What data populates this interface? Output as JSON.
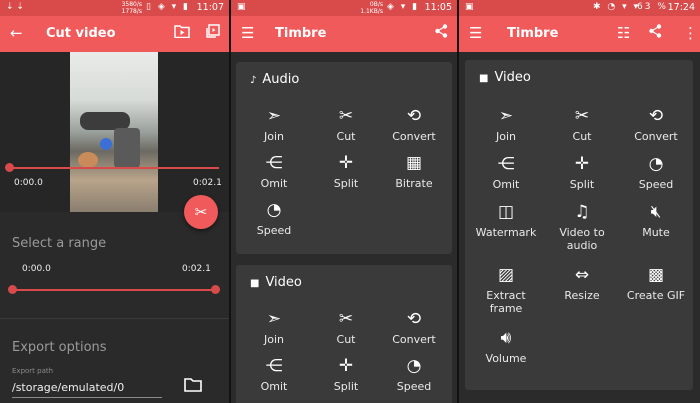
{
  "screen1": {
    "status": {
      "left": "⇣ ⇣",
      "speed": "3580/s\n1778/s",
      "time": "11:07"
    },
    "appbar": {
      "title": "Cut video"
    },
    "video": {
      "start_time": "0:00.0",
      "end_time": "0:02.1"
    },
    "range": {
      "title": "Select a range",
      "start": "0:00.0",
      "end": "0:02.1"
    },
    "export": {
      "title": "Export options",
      "label": "Export path",
      "value": "/storage/emulated/0"
    }
  },
  "screen2": {
    "status": {
      "time": "11:05",
      "speed": "0B/s\n1.1KB/s"
    },
    "appbar": {
      "title": "Timbre"
    },
    "audio_card": {
      "title": "Audio",
      "tools": [
        {
          "label": "Join",
          "icon": "join-icon"
        },
        {
          "label": "Cut",
          "icon": "scissors-icon"
        },
        {
          "label": "Convert",
          "icon": "convert-icon"
        },
        {
          "label": "Omit",
          "icon": "omit-icon"
        },
        {
          "label": "Split",
          "icon": "split-icon"
        },
        {
          "label": "Bitrate",
          "icon": "bitrate-icon"
        },
        {
          "label": "Speed",
          "icon": "speed-icon"
        }
      ]
    },
    "video_card": {
      "title": "Video",
      "tools": [
        {
          "label": "Join",
          "icon": "join-icon"
        },
        {
          "label": "Cut",
          "icon": "scissors-icon"
        },
        {
          "label": "Convert",
          "icon": "convert-icon"
        },
        {
          "label": "Omit",
          "icon": "omit-icon"
        },
        {
          "label": "Split",
          "icon": "split-icon"
        },
        {
          "label": "Speed",
          "icon": "speed-icon"
        }
      ]
    }
  },
  "screen3": {
    "status": {
      "battery": "63 %",
      "time": "17:24"
    },
    "appbar": {
      "title": "Timbre"
    },
    "video_card": {
      "title": "Video",
      "tools": [
        {
          "label": "Join",
          "icon": "join-icon"
        },
        {
          "label": "Cut",
          "icon": "scissors-icon"
        },
        {
          "label": "Convert",
          "icon": "convert-icon"
        },
        {
          "label": "Omit",
          "icon": "omit-icon"
        },
        {
          "label": "Split",
          "icon": "split-icon"
        },
        {
          "label": "Speed",
          "icon": "speed-icon"
        },
        {
          "label": "Watermark",
          "icon": "watermark-icon"
        },
        {
          "label": "Video to audio",
          "icon": "video-to-audio-icon"
        },
        {
          "label": "Mute",
          "icon": "mute-icon"
        },
        {
          "label": "Extract frame",
          "icon": "image-icon"
        },
        {
          "label": "Resize",
          "icon": "resize-icon"
        },
        {
          "label": "Create GIF",
          "icon": "gif-icon"
        },
        {
          "label": "Volume",
          "icon": "volume-icon"
        }
      ]
    }
  },
  "colors": {
    "accent": "#f05a5a",
    "status_bar": "#d94a4a",
    "card": "#3a3a3a",
    "background": "#2b2b2b"
  }
}
